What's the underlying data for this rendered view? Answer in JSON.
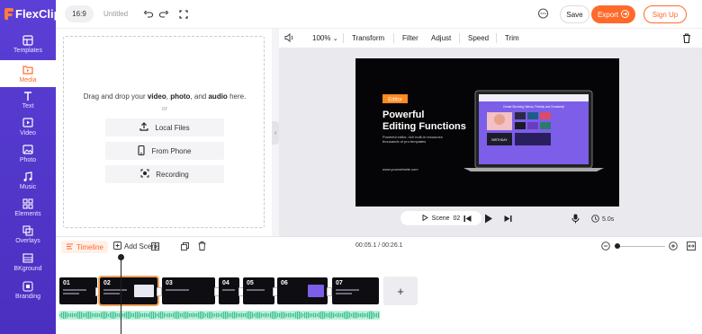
{
  "brand": {
    "name": "FlexClip",
    "accent": "#ff6a2b",
    "sidebar_color": "#5b3fd6"
  },
  "topbar": {
    "ratio": "16:9",
    "title": "Untitled",
    "save_label": "Save",
    "export_label": "Export",
    "signup_label": "Sign Up"
  },
  "sidebar": {
    "items": [
      {
        "label": "Templates",
        "icon": "templates-icon"
      },
      {
        "label": "Media",
        "icon": "media-icon",
        "active": true
      },
      {
        "label": "Text",
        "icon": "text-icon"
      },
      {
        "label": "Video",
        "icon": "video-icon"
      },
      {
        "label": "Photo",
        "icon": "photo-icon"
      },
      {
        "label": "Music",
        "icon": "music-icon"
      },
      {
        "label": "Elements",
        "icon": "elements-icon"
      },
      {
        "label": "Overlays",
        "icon": "overlays-icon"
      },
      {
        "label": "BKground",
        "icon": "background-icon"
      },
      {
        "label": "Branding",
        "icon": "branding-icon"
      }
    ]
  },
  "media": {
    "drop_prefix": "Drag and drop your",
    "drop_video": "video",
    "drop_sep1": ",",
    "drop_photo": "photo",
    "drop_sep2": ", and",
    "drop_audio": "audio",
    "drop_suffix": "here.",
    "or": "or",
    "buttons": [
      {
        "label": "Local Files",
        "icon": "upload-icon"
      },
      {
        "label": "From Phone",
        "icon": "phone-icon"
      },
      {
        "label": "Recording",
        "icon": "record-icon"
      }
    ]
  },
  "editor_toolbar": {
    "zoom": "100%",
    "items": [
      "Transform",
      "Filter",
      "Adjust",
      "Speed",
      "Trim"
    ]
  },
  "video": {
    "tag": "Editor",
    "headline_1": "Powerful",
    "headline_2": "Editing Functions",
    "body": "Powerful editor, rich built-in resources\nthousands of pro templates",
    "website": "www.yourwebsite.com",
    "screen_banner": "Create Stunning Videos, Flexibly and Creatively!",
    "screen_logo": "FlexClip",
    "screen_card": "BIRTHDAY"
  },
  "playback": {
    "scene_label": "Scene",
    "scene_number": "02",
    "duration": "5.0s"
  },
  "timeline": {
    "tab_label": "Timeline",
    "add_scene_label": "Add Scene",
    "time_display": "00:05.1 / 00:26.1",
    "zoom_level_fraction": 0.08,
    "clips": [
      {
        "num": "01",
        "text": "Title Template\nPowerful Editing"
      },
      {
        "num": "02",
        "text": "Powerful\nEditing"
      },
      {
        "num": "03",
        "text": "Create Slides"
      },
      {
        "num": "04",
        "text": ""
      },
      {
        "num": "05",
        "text": ""
      },
      {
        "num": "06",
        "text": ""
      },
      {
        "num": "07",
        "text": "Thank You\nFor Watching"
      }
    ],
    "add_clip_label": "+"
  }
}
